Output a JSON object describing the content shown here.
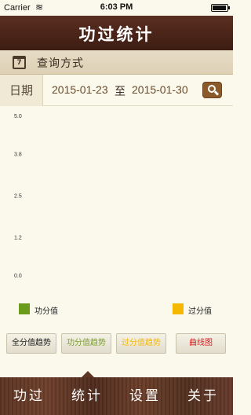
{
  "status_bar": {
    "carrier": "Carrier",
    "time": "6:03 PM"
  },
  "nav": {
    "title": "功过统计"
  },
  "query": {
    "label": "查询方式",
    "date_label": "日期",
    "start_date": "2015-01-23",
    "separator": "至",
    "end_date": "2015-01-30",
    "icons": {
      "calendar": "calendar-icon",
      "search": "search-icon"
    },
    "calendar_day": "7"
  },
  "chart_data": {
    "type": "line",
    "title": "",
    "xlabel": "",
    "ylabel": "",
    "y_ticks": [
      "5.0",
      "3.8",
      "2.5",
      "1.2",
      "0.0"
    ],
    "ylim": [
      0,
      5
    ],
    "grid": false,
    "series": [
      {
        "name": "功分值",
        "color": "#6a9b1b",
        "values": []
      },
      {
        "name": "过分值",
        "color": "#f5b800",
        "values": []
      }
    ],
    "legend_placement": "bottom"
  },
  "legend": [
    {
      "label": "功分值",
      "color": "#6a9b1b"
    },
    {
      "label": "过分值",
      "color": "#f5b800"
    }
  ],
  "buttons": [
    {
      "label": "全分值趋势",
      "color": "#1a1a1a"
    },
    {
      "label": "功分值趋势",
      "color": "#7aa02a"
    },
    {
      "label": "过分值趋势",
      "color": "#f5b800"
    },
    {
      "label": "曲线图",
      "color": "#d42020"
    }
  ],
  "tabs": [
    {
      "label": "功过",
      "selected": false
    },
    {
      "label": "统计",
      "selected": true
    },
    {
      "label": "设置",
      "selected": false
    },
    {
      "label": "关于",
      "selected": false
    }
  ],
  "colors": {
    "header_brown": "#4a2418",
    "accent_brown": "#8b5a2b",
    "background": "#fbf9ec"
  }
}
